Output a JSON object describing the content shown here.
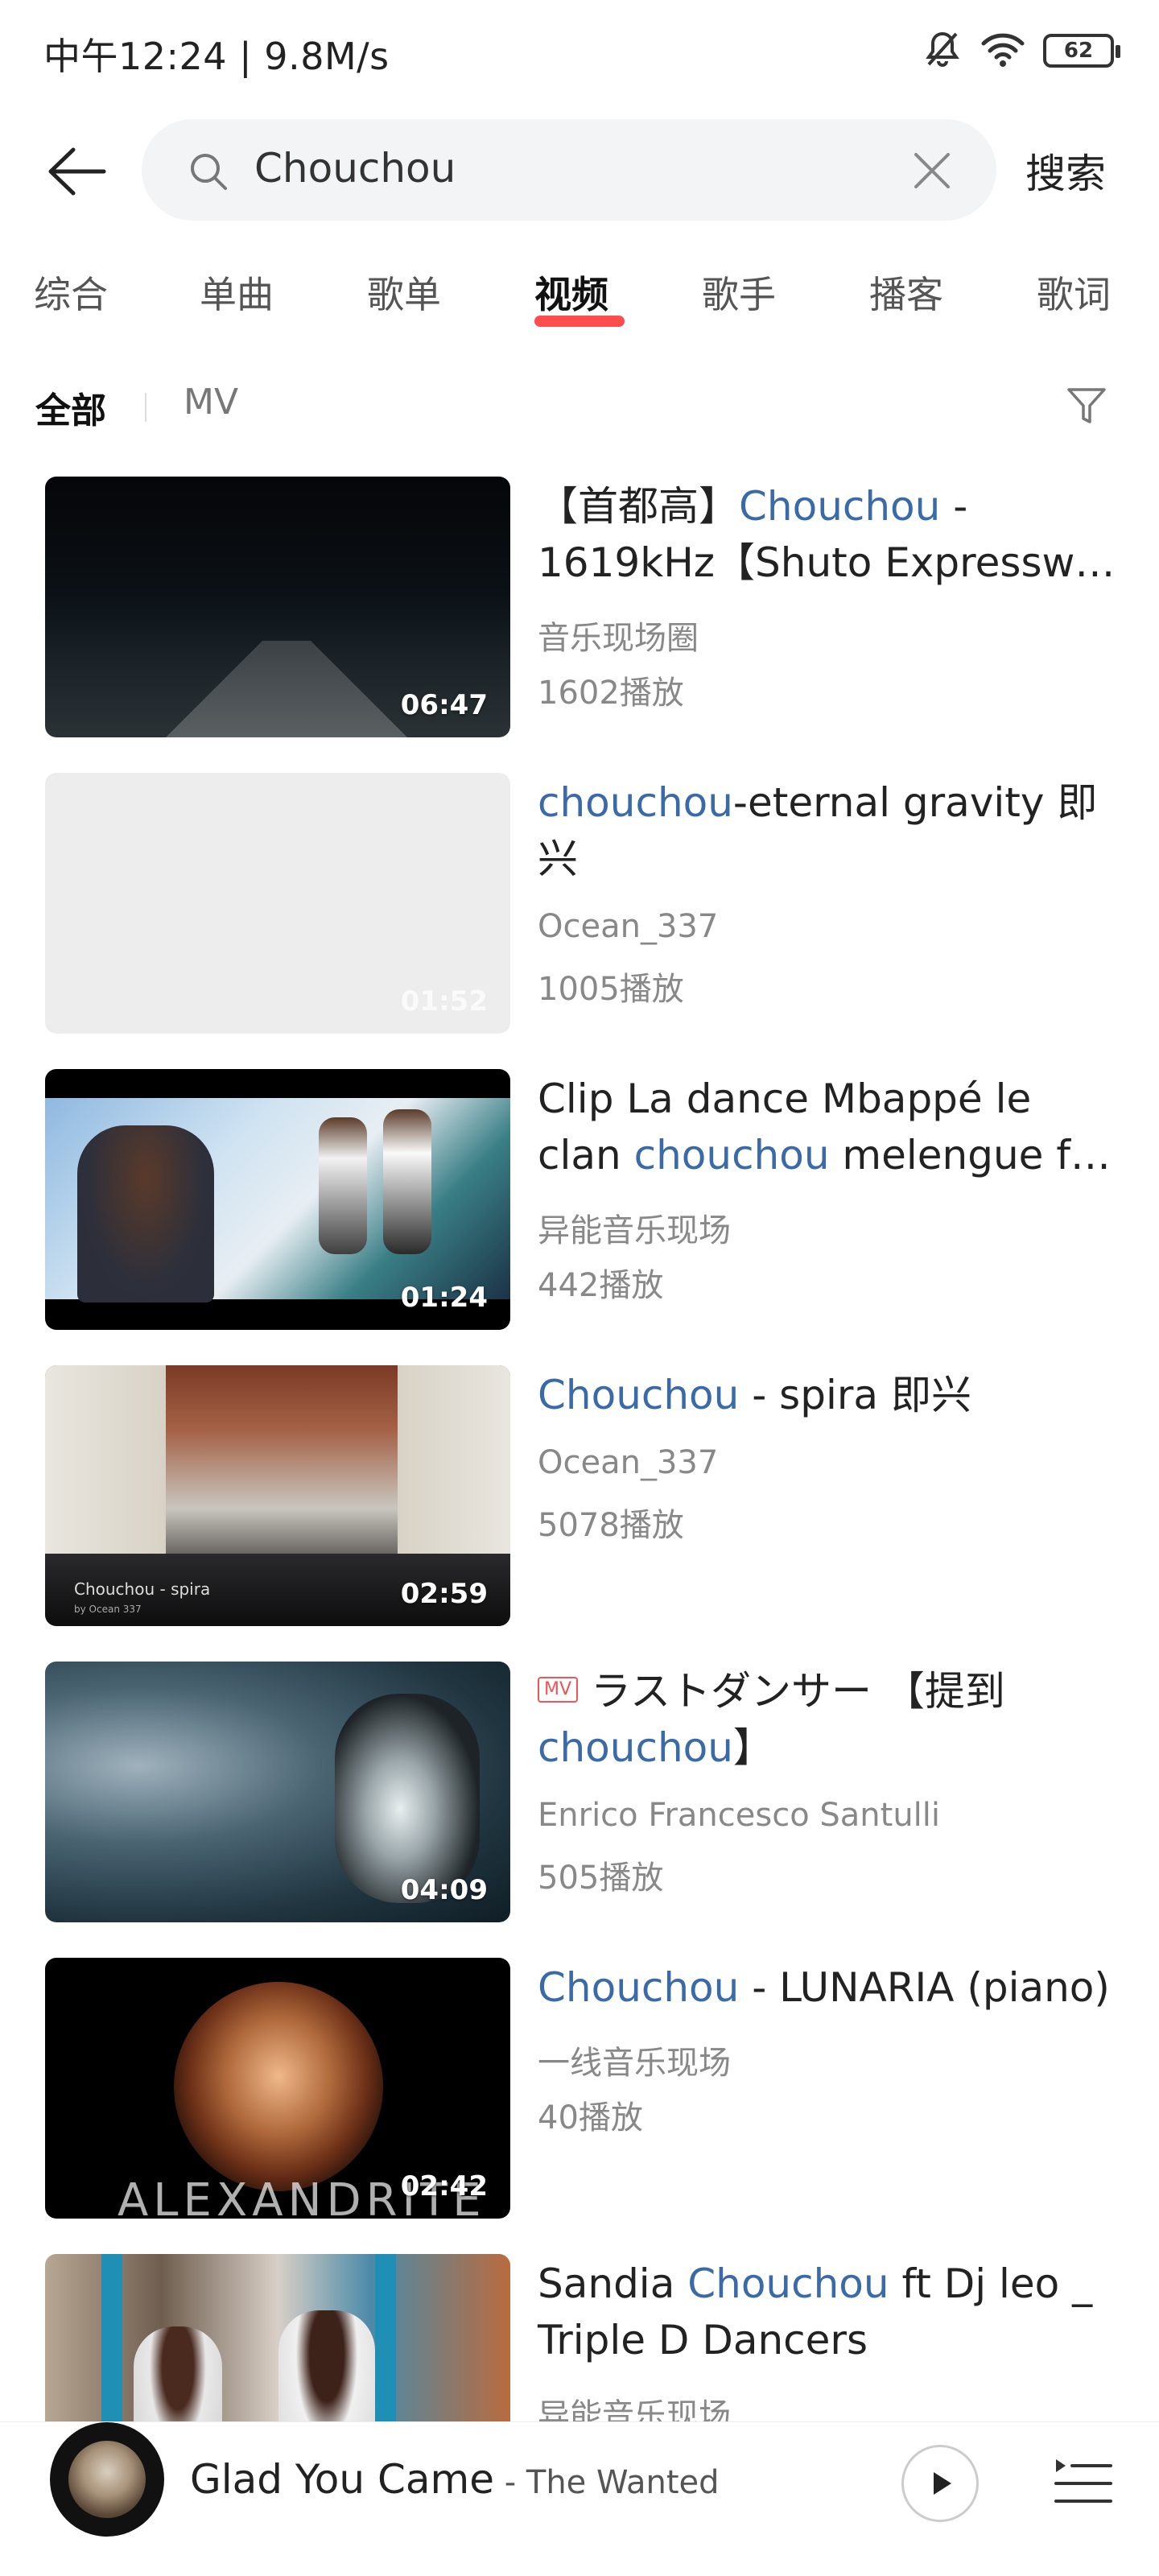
{
  "status": {
    "time_speed": "中午12:24 | 9.8M/s",
    "battery": "62",
    "icons": [
      "mute-bell-icon",
      "wifi-icon",
      "battery-icon"
    ]
  },
  "search": {
    "query": "Chouchou",
    "action_label": "搜索"
  },
  "tabs": [
    {
      "label": "综合"
    },
    {
      "label": "单曲"
    },
    {
      "label": "歌单"
    },
    {
      "label": "视频"
    },
    {
      "label": "歌手"
    },
    {
      "label": "播客"
    },
    {
      "label": "歌词"
    }
  ],
  "active_tab": "视频",
  "subfilter": {
    "all": "全部",
    "mv": "MV"
  },
  "videos": [
    {
      "title_pre": "【首都高】",
      "title_hl": "Chouchou",
      "title_post": " - 1619kHz【Shuto Expressw…",
      "uploader": "音乐现场圈",
      "plays": "1602播放",
      "duration": "06:47"
    },
    {
      "title_pre": "",
      "title_hl": "chouchou",
      "title_post": "-eternal gravity 即兴",
      "uploader": "Ocean_337",
      "plays": "1005播放",
      "duration": "01:52"
    },
    {
      "title_pre": "Clip La dance Mbappé le clan ",
      "title_hl": "chouchou",
      "title_post": " melengue f…",
      "uploader": "异能音乐现场",
      "plays": "442播放",
      "duration": "01:24"
    },
    {
      "title_pre": "",
      "title_hl": "Chouchou",
      "title_post": " - spira 即兴",
      "uploader": "Ocean_337",
      "plays": "5078播放",
      "duration": "02:59",
      "thumb_caption": "Chouchou - spira",
      "thumb_caption_sub": "by Ocean 337"
    },
    {
      "badge": "MV",
      "title_pre": "ラストダンサー 【提到",
      "title_hl": "chouchou",
      "title_post": "】",
      "uploader": "Enrico Francesco Santulli",
      "plays": "505播放",
      "duration": "04:09"
    },
    {
      "title_pre": "",
      "title_hl": "Chouchou",
      "title_post": " - LUNARIA (piano)",
      "uploader": "一线音乐现场",
      "plays": "40播放",
      "duration": "02:42",
      "thumb_text": "ALEXANDRITE"
    },
    {
      "title_pre": "Sandia ",
      "title_hl": "Chouchou",
      "title_post": " ft Dj leo _ Triple D Dancers",
      "uploader": "异能音乐现场",
      "plays": "",
      "duration": ""
    }
  ],
  "player": {
    "title": "Glad You Came",
    "artist": " - The Wanted"
  },
  "colors": {
    "highlight": "#3a6aa8",
    "tab_underline": "#ff3a3a"
  }
}
